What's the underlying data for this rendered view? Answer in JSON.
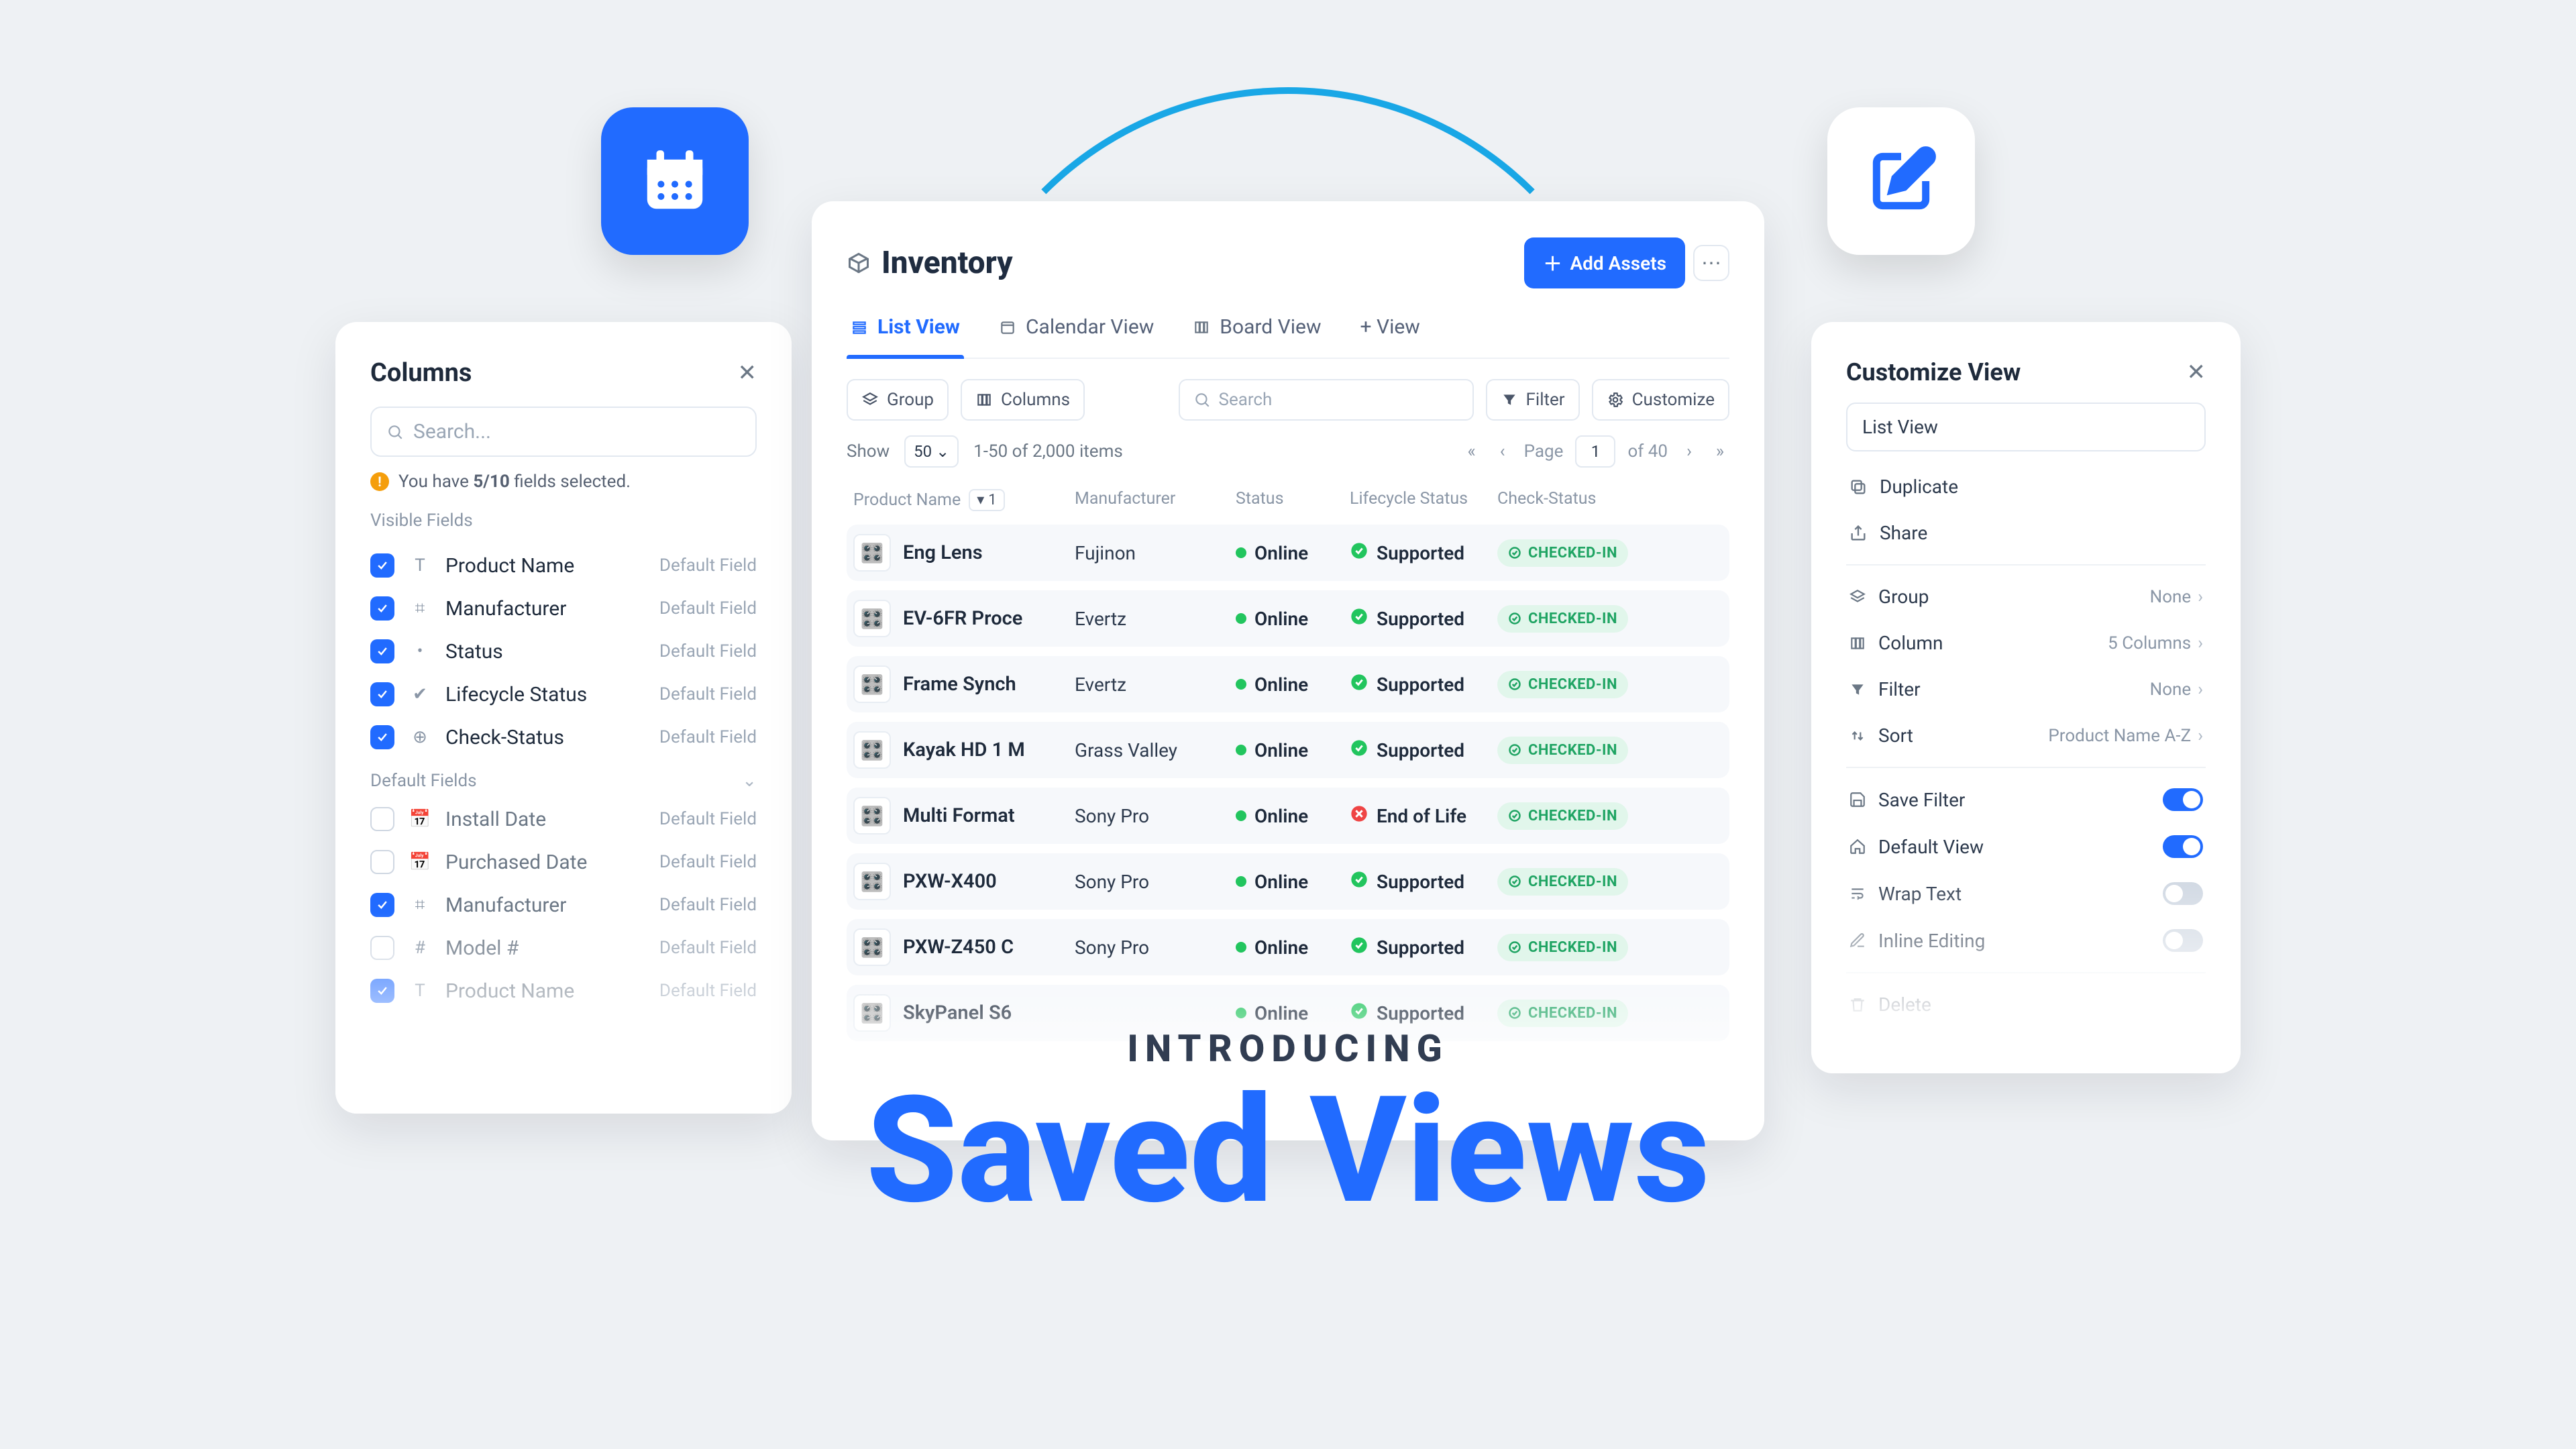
{
  "hero": {
    "kicker": "INTRODUCING",
    "main": "Saved Views"
  },
  "columnsPanel": {
    "title": "Columns",
    "searchPlaceholder": "Search...",
    "warnPrefix": "You have ",
    "warnBold": "5/10",
    "warnSuffix": " fields selected.",
    "visibleLabel": "Visible Fields",
    "defaultFieldsLabel": "Default Fields",
    "defaultFieldTag": "Default Field",
    "visible": [
      {
        "icon": "T",
        "name": "Product Name"
      },
      {
        "icon": "⌗",
        "name": "Manufacturer"
      },
      {
        "icon": "•",
        "name": "Status"
      },
      {
        "icon": "✔",
        "name": "Lifecycle Status"
      },
      {
        "icon": "⊕",
        "name": "Check-Status"
      }
    ],
    "extra": [
      {
        "checked": false,
        "icon": "📅",
        "name": "Install Date"
      },
      {
        "checked": false,
        "icon": "📅",
        "name": "Purchased Date"
      },
      {
        "checked": true,
        "icon": "⌗",
        "name": "Manufacturer"
      },
      {
        "checked": false,
        "icon": "#",
        "name": "Model #"
      },
      {
        "checked": true,
        "icon": "T",
        "name": "Product Name"
      }
    ]
  },
  "inventory": {
    "title": "Inventory",
    "addBtn": "Add Assets",
    "tabs": {
      "list": "List View",
      "calendar": "Calendar View",
      "board": "Board View",
      "add": "+ View"
    },
    "toolbar": {
      "group": "Group",
      "columns": "Columns",
      "searchPlaceholder": "Search",
      "filter": "Filter",
      "customize": "Customize"
    },
    "pagination": {
      "showLabel": "Show",
      "perPage": "50",
      "summary": "1-50 of 2,000 items",
      "pageLabel": "Page",
      "page": "1",
      "totalPages": "of 40"
    },
    "headers": {
      "name": "Product Name",
      "sortIndex": "1",
      "man": "Manufacturer",
      "status": "Status",
      "life": "Lifecycle Status",
      "check": "Check-Status"
    },
    "statusLabel": "Online",
    "supportedLabel": "Supported",
    "eolLabel": "End of Life",
    "checkedInLabel": "CHECKED-IN",
    "rows": [
      {
        "name": "Eng Lens",
        "man": "Fujinon",
        "life": "ok"
      },
      {
        "name": "EV-6FR Proce",
        "man": "Evertz",
        "life": "ok"
      },
      {
        "name": "Frame Synch",
        "man": "Evertz",
        "life": "ok"
      },
      {
        "name": "Kayak HD 1 M",
        "man": "Grass Valley",
        "life": "ok"
      },
      {
        "name": "Multi Format",
        "man": "Sony Pro",
        "life": "eol"
      },
      {
        "name": "PXW-X400",
        "man": "Sony Pro",
        "life": "ok"
      },
      {
        "name": "PXW-Z450 C",
        "man": "Sony Pro",
        "life": "ok"
      },
      {
        "name": "SkyPanel S6",
        "man": "",
        "life": "ok"
      }
    ]
  },
  "customize": {
    "title": "Customize View",
    "nameValue": "List View",
    "actions": {
      "duplicate": "Duplicate",
      "share": "Share"
    },
    "settings": {
      "group": {
        "label": "Group",
        "value": "None"
      },
      "column": {
        "label": "Column",
        "value": "5 Columns"
      },
      "filter": {
        "label": "Filter",
        "value": "None"
      },
      "sort": {
        "label": "Sort",
        "value": "Product Name A-Z"
      }
    },
    "toggles": {
      "saveFilter": {
        "label": "Save Filter",
        "on": true
      },
      "defaultView": {
        "label": "Default View",
        "on": true
      },
      "wrapText": {
        "label": "Wrap Text",
        "on": false
      },
      "inlineEditing": {
        "label": "Inline Editing",
        "on": false
      }
    },
    "delete": "Delete"
  }
}
